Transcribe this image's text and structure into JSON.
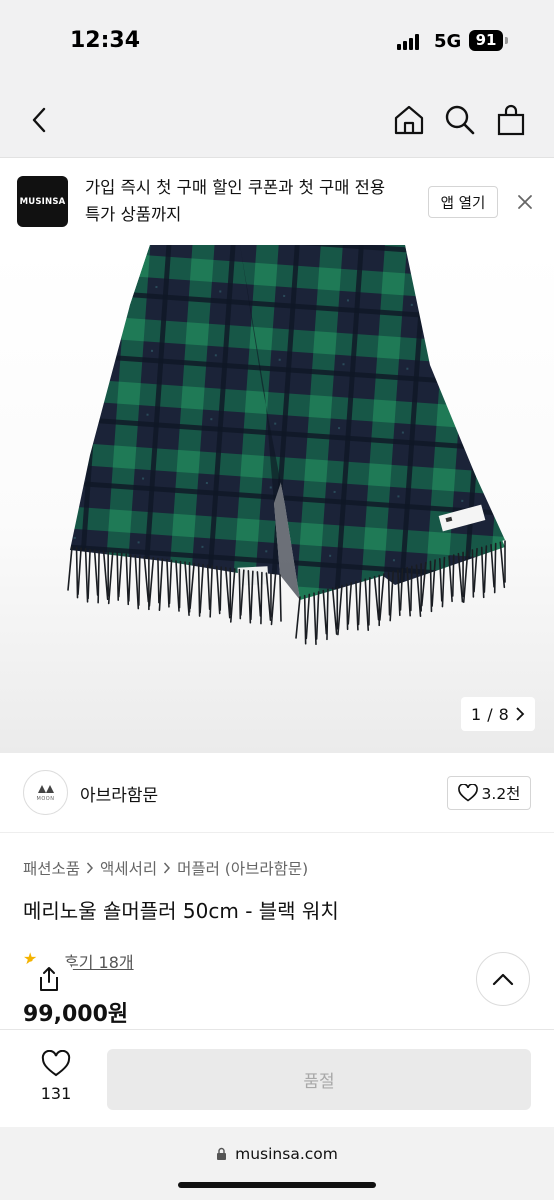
{
  "status_bar": {
    "time": "12:34",
    "network": "5G",
    "battery": "91"
  },
  "nav": {
    "icons": [
      "back-icon",
      "home-icon",
      "search-icon",
      "cart-icon"
    ]
  },
  "app_banner": {
    "logo_text": "MUSINSA",
    "message": "가입 즉시 첫 구매 할인 쿠폰과 첫 구매 전용 특가 상품까지",
    "open_app_label": "앱 열기"
  },
  "gallery": {
    "current": "1",
    "separator": "/",
    "total": "8"
  },
  "brand": {
    "logo_text": "MOON",
    "name": "아브라함문",
    "likes": "3.2천"
  },
  "product": {
    "breadcrumb": [
      "패션소품",
      "액세서리",
      "머플러 (아브라함문)"
    ],
    "title": "메리노울 숄머플러 50cm - 블랙 워치",
    "reviews_label": "후기 18개",
    "price": "99,000원"
  },
  "buy_bar": {
    "wish_count": "131",
    "soldout_label": "품절"
  },
  "browser": {
    "url": "musinsa.com"
  },
  "colors": {
    "scarf_green": "#16614a",
    "scarf_navy": "#1b2338",
    "soldout_bg": "#eaeaea"
  }
}
